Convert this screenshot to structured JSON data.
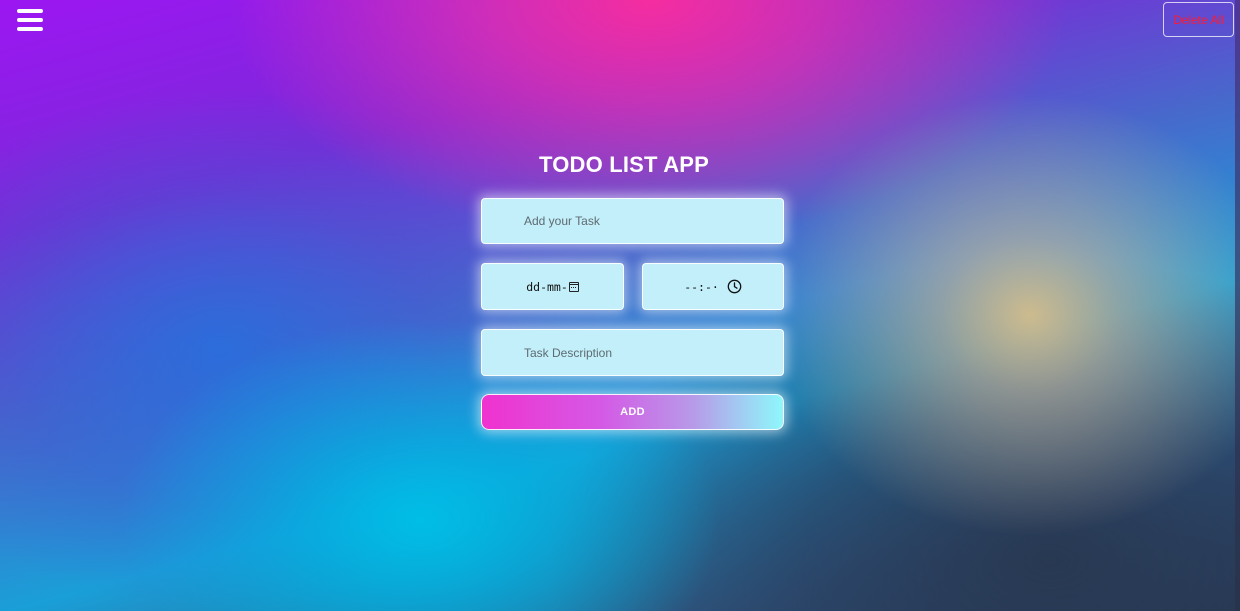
{
  "header": {
    "menu_icon": "hamburger-menu-icon",
    "delete_all_label": "Delete All",
    "delete_all_color": "#ff1a2e"
  },
  "app": {
    "title": "TODO LIST APP"
  },
  "form": {
    "task_placeholder": "Add your Task",
    "date_display": "dd-mm-",
    "date_icon": "calendar-icon",
    "time_display": "--:-·",
    "time_icon": "clock-icon",
    "description_placeholder": "Task Description",
    "add_label": "ADD"
  },
  "colors": {
    "field_background": "#c2effa",
    "add_gradient_start": "#f032cf",
    "add_gradient_end": "#8ef8fb"
  }
}
